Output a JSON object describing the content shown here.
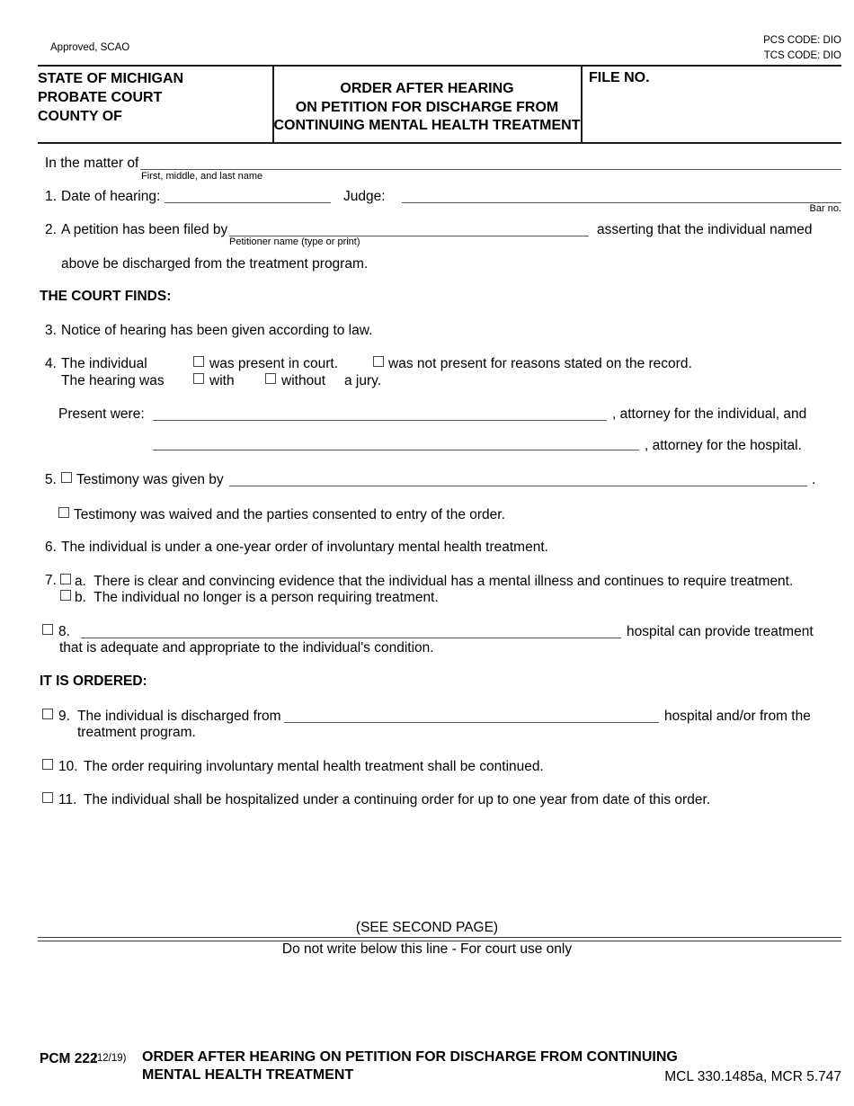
{
  "meta": {
    "approved": "Approved, SCAO",
    "pcs_code": "PCS CODE: DIO",
    "tcs_code": "TCS CODE: DIO"
  },
  "header": {
    "court_line1": "STATE OF MICHIGAN",
    "court_line2": "PROBATE COURT",
    "court_line3": "COUNTY OF",
    "title_line1": "ORDER AFTER HEARING",
    "title_line2": "ON PETITION FOR DISCHARGE FROM",
    "title_line3": "CONTINUING MENTAL HEALTH TREATMENT",
    "file_no_label": "FILE NO."
  },
  "matter": {
    "label": "In the matter of",
    "caption": "First, middle, and last name"
  },
  "item1": {
    "number": "1.",
    "date_label": "Date of hearing:",
    "judge_label": "Judge:",
    "bar_no_caption": "Bar no."
  },
  "item2": {
    "number": "2.",
    "text_before": "A petition has been filed by",
    "petitioner_caption": "Petitioner name (type or print)",
    "text_after": "asserting that the individual named",
    "text_line2": "above be discharged from the treatment program."
  },
  "findings_heading": "THE COURT FINDS:",
  "item3": {
    "number": "3.",
    "text": "Notice of hearing has been given according to law."
  },
  "item4": {
    "number": "4.",
    "label_individual": "The individual",
    "opt_present": "was present in court.",
    "opt_not_present": "was not present for reasons stated on the record.",
    "label_hearing": "The hearing was",
    "opt_with": "with",
    "opt_without": "without",
    "opt_jury": "a jury.",
    "present_were_label": "Present were:",
    "attorney_individual": ", attorney for the individual, and",
    "attorney_hospital": ", attorney for the hospital."
  },
  "item5": {
    "number": "5.",
    "opt_a": "Testimony was given by",
    "period": ".",
    "opt_b": "Testimony was waived and the parties consented to entry of the order."
  },
  "item6": {
    "number": "6.",
    "text": "The individual is under a one-year order of involuntary mental health treatment."
  },
  "item7": {
    "number": "7.",
    "opt_a": "a.  There is clear and convincing evidence that the individual has a mental illness and continues to require treatment.",
    "opt_b": "b.  The individual no longer is a person requiring treatment."
  },
  "item8": {
    "number": "8.",
    "text_after": "hospital can provide treatment",
    "text_line2": "that is adequate and appropriate to the individual's condition."
  },
  "ordered_heading": "IT IS ORDERED:",
  "item9": {
    "number": "9.",
    "text_before": "The individual is discharged from",
    "text_after": "hospital and/or from the",
    "text_line2": "treatment program."
  },
  "item10": {
    "number": "10.",
    "text": "The order requiring involuntary mental health treatment shall be continued."
  },
  "item11": {
    "number": "11.",
    "text": "The individual shall be hospitalized under a continuing order for up to one year from date of this order."
  },
  "footer": {
    "see_second_page": "(SEE SECOND PAGE)",
    "do_not_write": "Do not write below this line - For court use only",
    "form_no": "PCM 222",
    "form_rev": "(12/19)",
    "form_title_line1": "ORDER AFTER HEARING ON PETITION FOR DISCHARGE FROM CONTINUING",
    "form_title_line2": "MENTAL HEALTH TREATMENT",
    "citation": "MCL 330.1485a, MCR 5.747"
  }
}
